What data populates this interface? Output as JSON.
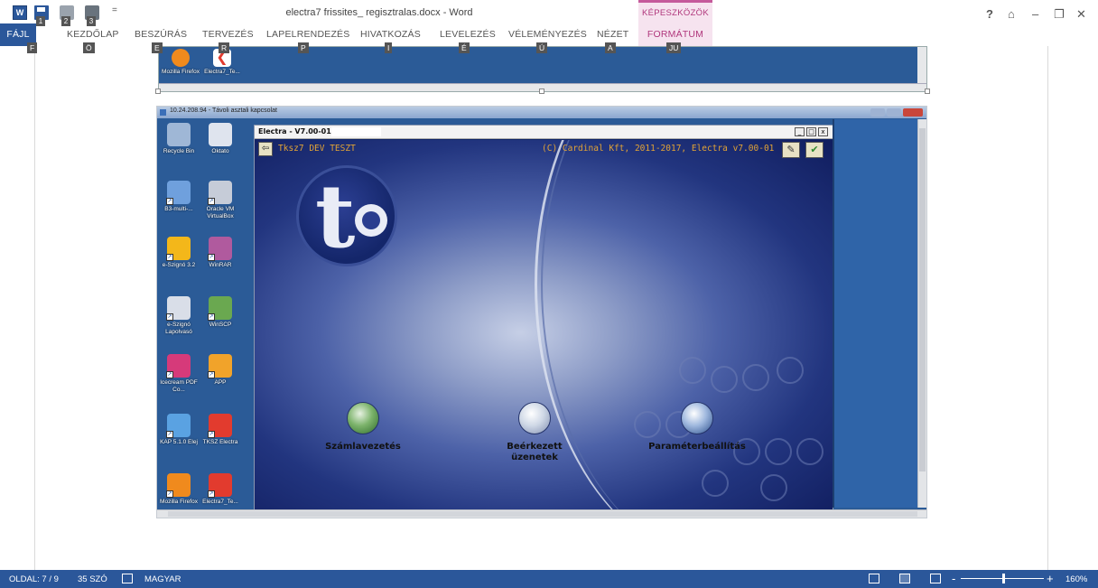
{
  "window": {
    "title": "electra7 frissites_ regisztralas.docx - Word",
    "tools_title": "KÉPESZKÖZÖK",
    "help": "?",
    "controls": [
      "⌂",
      "–",
      "❐",
      "✕"
    ]
  },
  "quick_access": {
    "keytips": [
      "1",
      "2",
      "3"
    ],
    "more": "="
  },
  "tabs": [
    {
      "label": "FÁJL",
      "key": "F"
    },
    {
      "label": "KEZDŐLAP",
      "key": "Ö"
    },
    {
      "label": "BESZÚRÁS",
      "key": "E"
    },
    {
      "label": "TERVEZÉS",
      "key": "R"
    },
    {
      "label": "LAPELRENDEZÉS",
      "key": "P"
    },
    {
      "label": "HIVATKOZÁS",
      "key": "I"
    },
    {
      "label": "LEVELEZÉS",
      "key": "É"
    },
    {
      "label": "VÉLEMÉNYEZÉS",
      "key": "Ú"
    },
    {
      "label": "NÉZET",
      "key": "A"
    },
    {
      "label": "FORMÁTUM",
      "key": "JU"
    }
  ],
  "top_image": {
    "icons": [
      {
        "label": "Mozilla Firefox"
      },
      {
        "label": "Electra7_Te..."
      }
    ]
  },
  "rdp": {
    "title": "10.24.208.94 - Távoli asztali kapcsolat",
    "desktop_icons": [
      {
        "label": "Recycle Bin",
        "icon": "recycle-bin-icon",
        "color": "#9fb7d6"
      },
      {
        "label": "Oktato",
        "icon": "spiral-icon",
        "color": "#dfe4ee"
      },
      {
        "label": "B3-multi-...",
        "icon": "computer-icon",
        "color": "#6fa0dd"
      },
      {
        "label": "Oracle VM VirtualBox",
        "icon": "virtualbox-icon",
        "color": "#c6ccd8"
      },
      {
        "label": "e-Szignó 3.2",
        "icon": "eszigno-icon",
        "color": "#f3b71a"
      },
      {
        "label": "WinRAR",
        "icon": "winrar-icon",
        "color": "#b05a9e"
      },
      {
        "label": "e-Szignó Lapolvasó",
        "icon": "scanner-icon",
        "color": "#d9dee8"
      },
      {
        "label": "WinSCP",
        "icon": "winscp-icon",
        "color": "#6aa850"
      },
      {
        "label": "Icecream PDF Co...",
        "icon": "pdf-icon",
        "color": "#d63a7a"
      },
      {
        "label": "APP",
        "icon": "key-icon",
        "color": "#f1a32a"
      },
      {
        "label": "KAP 5.1.0 Elej",
        "icon": "kap-icon",
        "color": "#5aa2e2"
      },
      {
        "label": "TKSZ Electra",
        "icon": "electra-icon",
        "color": "#e23b2e"
      },
      {
        "label": "Mozilla Firefox",
        "icon": "firefox-icon",
        "color": "#f08a1d"
      },
      {
        "label": "Electra7_Te...",
        "icon": "electra-icon",
        "color": "#e23b2e"
      }
    ]
  },
  "electra": {
    "title": "Electra - V7.00-01(15) -",
    "name": "Tksz7 DEV TESZT",
    "copyright": "(C) Cardinal Kft, 2011-2017, Electra v7.00-01",
    "exit_glyph": "⇦",
    "btn1_glyph": "✎",
    "btn2_glyph": "✔",
    "menu": [
      {
        "label": "Számlavezetés",
        "icon": "accounts-icon"
      },
      {
        "label": "Beérkezett üzenetek",
        "icon": "messages-icon"
      },
      {
        "label": "Paraméterbeállítás",
        "icon": "settings-icon"
      }
    ]
  },
  "status": {
    "page": "OLDAL: 7 / 9",
    "words": "35 SZÓ",
    "language": "MAGYAR",
    "zoom": "160%",
    "zoom_minus": "-",
    "zoom_plus": "+"
  }
}
